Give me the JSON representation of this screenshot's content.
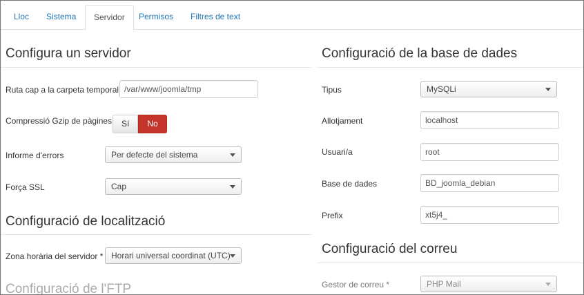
{
  "tabs": [
    "Lloc",
    "Sistema",
    "Servidor",
    "Permisos",
    "Filtres de text"
  ],
  "server": {
    "title": "Configura un servidor",
    "temp_path_label": "Ruta cap a la carpeta temporal",
    "temp_path_value": "/var/www/joomla/tmp",
    "gzip_label": "Compressió Gzip de pàgines",
    "gzip_yes": "Sí",
    "gzip_no": "No",
    "error_label": "Informe d'errors",
    "error_value": "Per defecte del sistema",
    "ssl_label": "Força SSL",
    "ssl_value": "Cap"
  },
  "locale": {
    "title": "Configuració de localització",
    "tz_label": "Zona horària del servidor *",
    "tz_value": "Horari universal coordinat (UTC)"
  },
  "ftp": {
    "title": "Configuració de l'FTP"
  },
  "database": {
    "title": "Configuració de la base de dades",
    "type_label": "Tipus",
    "type_value": "MySQLi",
    "host_label": "Allotjament",
    "host_value": "localhost",
    "user_label": "Usuari/a",
    "user_value": "root",
    "db_label": "Base de dades",
    "db_value": "BD_joomla_debian",
    "prefix_label": "Prefix",
    "prefix_value": "xt5j4_"
  },
  "mail": {
    "title": "Configuració del correu",
    "mailer_label": "Gestor de correu *",
    "mailer_value": "PHP Mail"
  },
  "colors": {
    "link": "#1f74b5",
    "danger": "#c4342b"
  }
}
